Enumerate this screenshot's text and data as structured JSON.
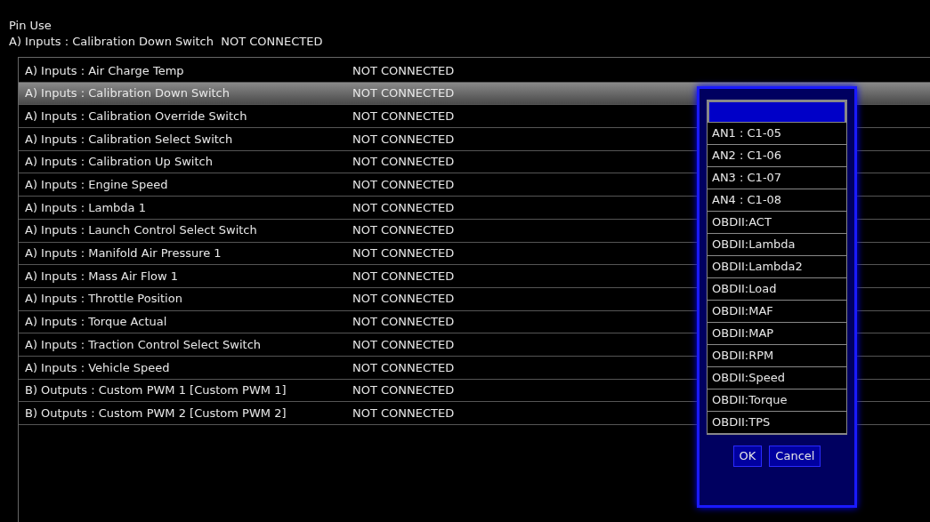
{
  "header": {
    "label": "Pin Use",
    "current": "A) Inputs : Calibration Down Switch  NOT CONNECTED"
  },
  "table": {
    "rows": [
      {
        "name": "A) Inputs : Air Charge Temp",
        "status": "NOT CONNECTED",
        "selected": false
      },
      {
        "name": "A) Inputs : Calibration Down Switch",
        "status": "NOT CONNECTED",
        "selected": true
      },
      {
        "name": "A) Inputs : Calibration Override Switch",
        "status": "NOT CONNECTED",
        "selected": false
      },
      {
        "name": "A) Inputs : Calibration Select Switch",
        "status": "NOT CONNECTED",
        "selected": false
      },
      {
        "name": "A) Inputs : Calibration Up Switch",
        "status": "NOT CONNECTED",
        "selected": false
      },
      {
        "name": "A) Inputs : Engine Speed",
        "status": "NOT CONNECTED",
        "selected": false
      },
      {
        "name": "A) Inputs : Lambda 1",
        "status": "NOT CONNECTED",
        "selected": false
      },
      {
        "name": "A) Inputs : Launch Control Select Switch",
        "status": "NOT CONNECTED",
        "selected": false
      },
      {
        "name": "A) Inputs : Manifold Air Pressure 1",
        "status": "NOT CONNECTED",
        "selected": false
      },
      {
        "name": "A) Inputs : Mass Air Flow 1",
        "status": "NOT CONNECTED",
        "selected": false
      },
      {
        "name": "A) Inputs : Throttle Position",
        "status": "NOT CONNECTED",
        "selected": false
      },
      {
        "name": "A) Inputs : Torque Actual",
        "status": "NOT CONNECTED",
        "selected": false
      },
      {
        "name": "A) Inputs : Traction Control Select Switch",
        "status": "NOT CONNECTED",
        "selected": false
      },
      {
        "name": "A) Inputs : Vehicle Speed",
        "status": "NOT CONNECTED",
        "selected": false
      },
      {
        "name": "B) Outputs : Custom PWM 1 [Custom PWM 1]",
        "status": "NOT CONNECTED",
        "selected": false
      },
      {
        "name": "B) Outputs : Custom PWM 2 [Custom PWM 2]",
        "status": "NOT CONNECTED",
        "selected": false
      }
    ]
  },
  "dialog": {
    "options": [
      {
        "selected": true
      },
      {
        "label": "AN1 : C1-05",
        "selected": false
      },
      {
        "label": "AN2 : C1-06",
        "selected": false
      },
      {
        "label": "AN3 : C1-07",
        "selected": false
      },
      {
        "label": "AN4 : C1-08",
        "selected": false
      },
      {
        "label": "OBDII:ACT",
        "selected": false
      },
      {
        "label": "OBDII:Lambda",
        "selected": false
      },
      {
        "label": "OBDII:Lambda2",
        "selected": false
      },
      {
        "label": "OBDII:Load",
        "selected": false
      },
      {
        "label": "OBDII:MAF",
        "selected": false
      },
      {
        "label": "OBDII:MAP",
        "selected": false
      },
      {
        "label": "OBDII:RPM",
        "selected": false
      },
      {
        "label": "OBDII:Speed",
        "selected": false
      },
      {
        "label": "OBDII:Torque",
        "selected": false
      },
      {
        "label": "OBDII:TPS",
        "selected": false
      }
    ],
    "buttons": [
      "OK",
      "Cancel"
    ]
  }
}
